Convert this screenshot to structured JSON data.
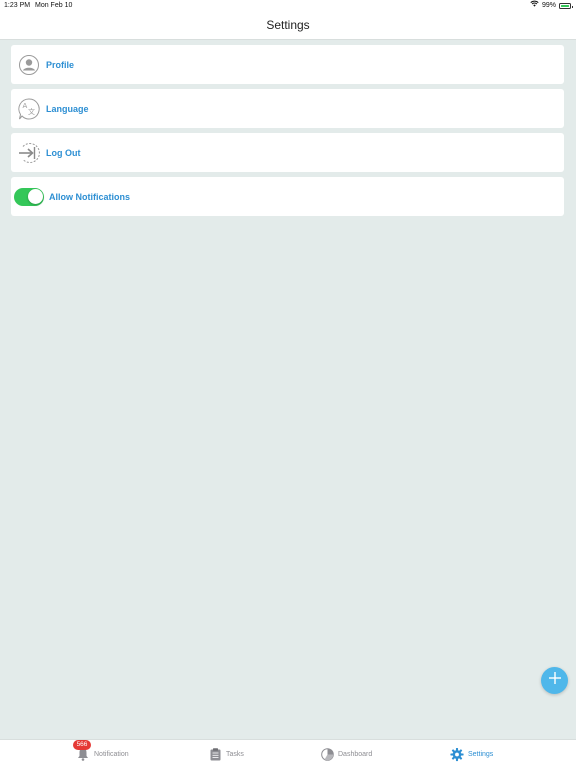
{
  "status_bar": {
    "time": "1:23 PM",
    "date": "Mon Feb 10",
    "battery": "99%",
    "battery_level": 0.99
  },
  "header": {
    "title": "Settings"
  },
  "settings": {
    "items": [
      {
        "label": "Profile",
        "icon": "profile-icon"
      },
      {
        "label": "Language",
        "icon": "language-icon"
      },
      {
        "label": "Log Out",
        "icon": "logout-icon"
      }
    ],
    "notifications": {
      "label": "Allow Notifications",
      "enabled": true
    }
  },
  "fab": {
    "icon": "plus-icon"
  },
  "tab_bar": {
    "tabs": [
      {
        "label": "Notification",
        "icon": "bell-icon",
        "badge": "566",
        "active": false
      },
      {
        "label": "Tasks",
        "icon": "clipboard-icon",
        "active": false
      },
      {
        "label": "Dashboard",
        "icon": "pie-chart-icon",
        "active": false
      },
      {
        "label": "Settings",
        "icon": "gear-icon",
        "active": true
      }
    ]
  },
  "colors": {
    "accent": "#2d8fd3",
    "toggle_on": "#34c759",
    "fab": "#4fb7ea",
    "badge": "#e53935",
    "background": "#e3ebea"
  }
}
